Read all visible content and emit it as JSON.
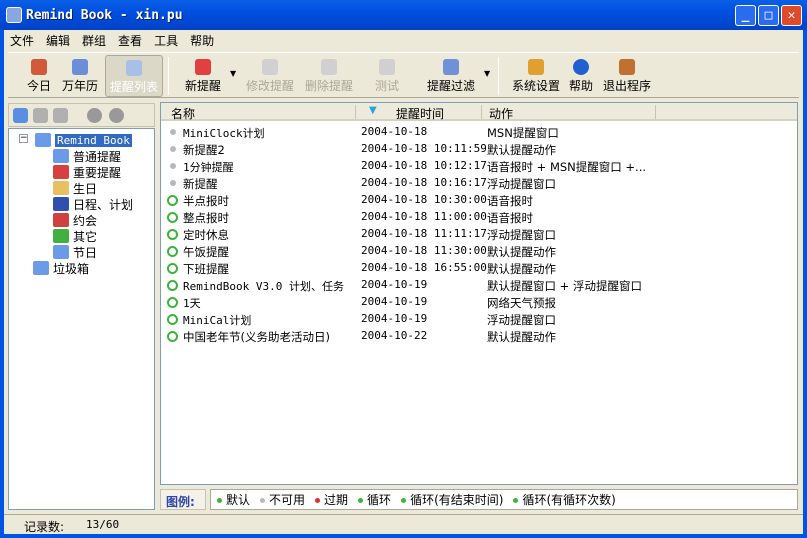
{
  "window": {
    "title": "Remind Book - xin.pu"
  },
  "menu": [
    "文件",
    "编辑",
    "群组",
    "查看",
    "工具",
    "帮助"
  ],
  "toolbar": {
    "today": "今日",
    "calendar": "万年历",
    "remind_list": "提醒列表",
    "new": "新提醒",
    "edit": "修改提醒",
    "delete": "删除提醒",
    "test": "测试",
    "filter": "提醒过滤",
    "settings": "系统设置",
    "help": "帮助",
    "exit": "退出程序"
  },
  "tree": {
    "root": "Remind Book",
    "children": [
      "普通提醒",
      "重要提醒",
      "生日",
      "日程、计划",
      "约会",
      "其它",
      "节日"
    ],
    "trash": "垃圾箱"
  },
  "list": {
    "columns": [
      "名称",
      "提醒时间",
      "动作"
    ],
    "rows": [
      {
        "icon": "unavailable",
        "name": "MiniClock计划",
        "time": "2004-10-18",
        "action": "MSN提醒窗口"
      },
      {
        "icon": "unavailable",
        "name": "新提醒2",
        "time": "2004-10-18 10:11:59",
        "action": "默认提醒动作"
      },
      {
        "icon": "unavailable",
        "name": "1分钟提醒",
        "time": "2004-10-18 10:12:17",
        "action": "语音报时 + MSN提醒窗口 +..."
      },
      {
        "icon": "unavailable",
        "name": "新提醒",
        "time": "2004-10-18 10:16:17",
        "action": "浮动提醒窗口"
      },
      {
        "icon": "loop",
        "name": "半点报时",
        "time": "2004-10-18 10:30:00",
        "action": "语音报时"
      },
      {
        "icon": "loop",
        "name": "整点报时",
        "time": "2004-10-18 11:00:00",
        "action": "语音报时"
      },
      {
        "icon": "loop",
        "name": "定时休息",
        "time": "2004-10-18 11:11:17",
        "action": "浮动提醒窗口"
      },
      {
        "icon": "loop",
        "name": "午饭提醒",
        "time": "2004-10-18 11:30:00",
        "action": "默认提醒动作"
      },
      {
        "icon": "loop",
        "name": "下班提醒",
        "time": "2004-10-18 16:55:00",
        "action": "默认提醒动作"
      },
      {
        "icon": "loop",
        "name": "RemindBook V3.0 计划、任务",
        "time": "2004-10-19",
        "action": "默认提醒窗口 + 浮动提醒窗口"
      },
      {
        "icon": "loop",
        "name": "1天",
        "time": "2004-10-19",
        "action": "网络天气预报"
      },
      {
        "icon": "loop",
        "name": "MiniCal计划",
        "time": "2004-10-19",
        "action": "浮动提醒窗口"
      },
      {
        "icon": "loop",
        "name": "中国老年节(义务助老活动日)",
        "time": "2004-10-22",
        "action": "默认提醒动作"
      }
    ]
  },
  "legend": {
    "label": "图例:",
    "items": [
      {
        "text": "默认",
        "color": "#4caf30"
      },
      {
        "text": "不可用",
        "color": "#b8b8b8"
      },
      {
        "text": "过期",
        "color": "#e03030"
      },
      {
        "text": "循环",
        "color": "#3cb43c"
      },
      {
        "text": "循环(有结束时间)",
        "color": "#3cb43c"
      },
      {
        "text": "循环(有循环次数)",
        "color": "#3cb43c"
      }
    ]
  },
  "status": {
    "label": "记录数:",
    "value": "13/60"
  }
}
